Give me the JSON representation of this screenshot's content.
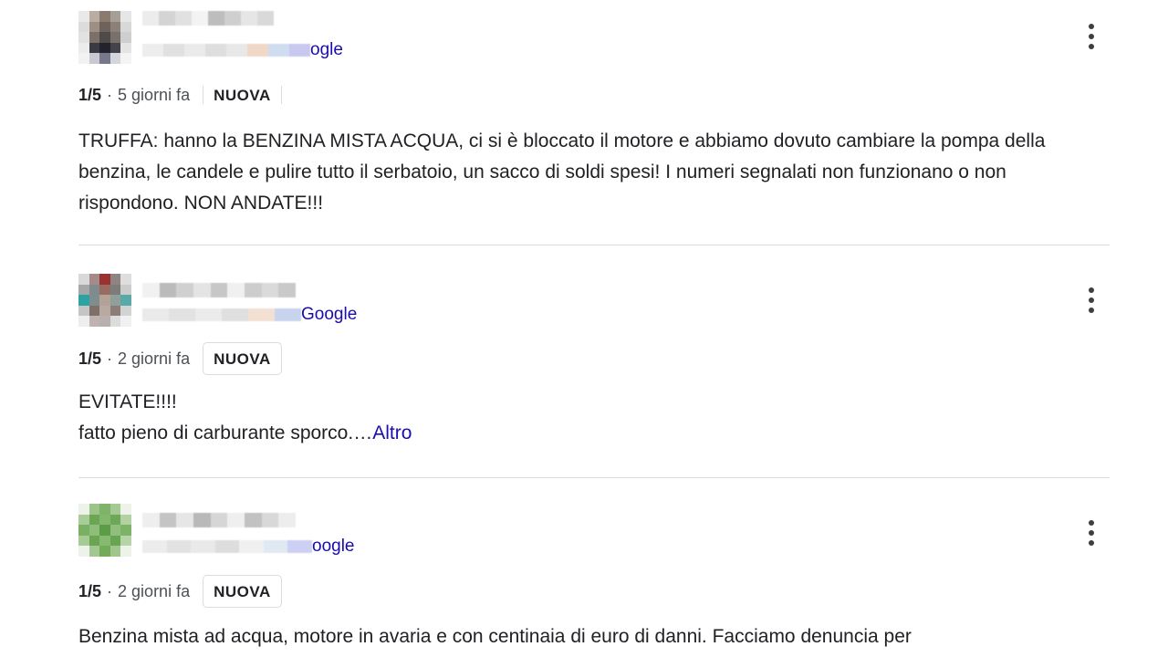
{
  "reviews": [
    {
      "source_suffix": "ogle",
      "rating": "1/5",
      "time": "5 giorni fa",
      "badge": "NUOVA",
      "text": "TRUFFA: hanno la BENZINA MISTA ACQUA, ci si è bloccato il motore e abbiamo dovuto cambiare la pompa della benzina, le candele e pulire tutto il serbatoio, un sacco di soldi spesi! I numeri segnalati non funzionano o non rispondono. NON ANDATE!!!",
      "more": ""
    },
    {
      "source_suffix": "Google",
      "rating": "1/5",
      "time": "2 giorni fa",
      "badge": "NUOVA",
      "text_line1": "EVITATE!!!!",
      "text_line2": "fatto pieno di carburante sporco.…",
      "more": "Altro"
    },
    {
      "source_suffix": "oogle",
      "rating": "1/5",
      "time": "2 giorni fa",
      "badge": "NUOVA",
      "text": "Benzina mista ad acqua, motore in avaria e con centinaia di euro di danni. Facciamo denuncia per",
      "more": ""
    }
  ],
  "separator": "·"
}
